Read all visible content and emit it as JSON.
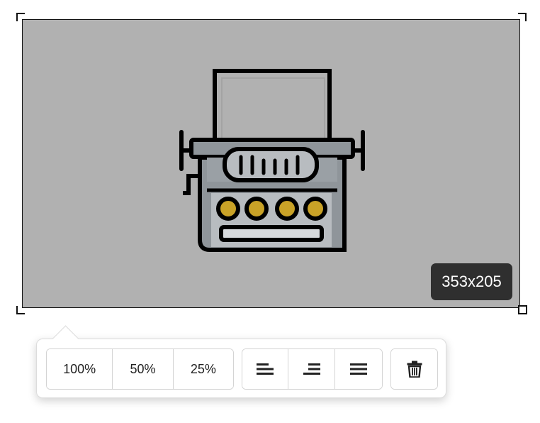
{
  "image": {
    "dimensions_label": "353x205",
    "background_color": "#b1b1b1",
    "subject_icon": "typewriter-illustration"
  },
  "toolbar": {
    "size_buttons": [
      {
        "label": "100%"
      },
      {
        "label": "50%"
      },
      {
        "label": "25%"
      }
    ],
    "align_buttons": [
      {
        "icon": "align-left-icon"
      },
      {
        "icon": "align-right-icon"
      },
      {
        "icon": "align-justify-icon"
      }
    ],
    "delete_button": {
      "icon": "trash-icon"
    }
  }
}
